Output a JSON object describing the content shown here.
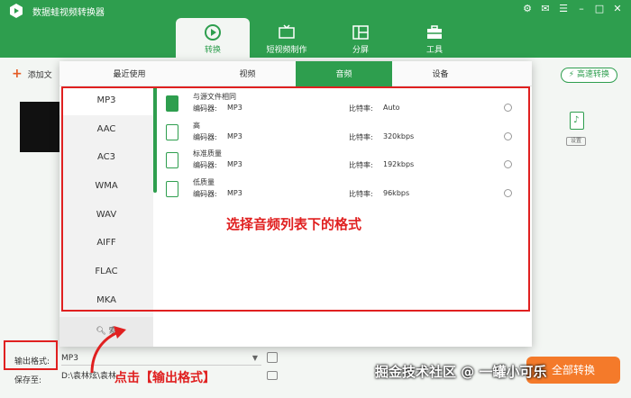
{
  "app": {
    "title": "数据蛙视频转换器"
  },
  "nav": [
    {
      "label": "转换",
      "icon": "convert-icon"
    },
    {
      "label": "短视频制作",
      "icon": "tv-icon"
    },
    {
      "label": "分屏",
      "icon": "split-screen-icon"
    },
    {
      "label": "工具",
      "icon": "toolbox-icon"
    }
  ],
  "main": {
    "add_file": "添加文",
    "fast_convert": "高速转换",
    "format_chip": {
      "settings": "设置"
    }
  },
  "popup": {
    "tabs": [
      "最近使用",
      "视频",
      "音频",
      "设备"
    ],
    "active_tab": "音频",
    "formats": [
      "MP3",
      "AAC",
      "AC3",
      "WMA",
      "WAV",
      "AIFF",
      "FLAC",
      "MKA"
    ],
    "active_format": "MP3",
    "search_label": "索",
    "quality": [
      {
        "name": "与源文件相同",
        "encoder_label": "编码器:",
        "encoder": "MP3",
        "bitrate_label": "比特率:",
        "bitrate": "Auto"
      },
      {
        "name": "高",
        "encoder_label": "编码器:",
        "encoder": "MP3",
        "bitrate_label": "比特率:",
        "bitrate": "320kbps"
      },
      {
        "name": "标准质量",
        "encoder_label": "编码器:",
        "encoder": "MP3",
        "bitrate_label": "比特率:",
        "bitrate": "192kbps"
      },
      {
        "name": "低质量",
        "encoder_label": "编码器:",
        "encoder": "MP3",
        "bitrate_label": "比特率:",
        "bitrate": "96kbps"
      }
    ]
  },
  "bottom": {
    "output_label": "输出格式:",
    "output_value": "MP3",
    "save_label": "保存至:",
    "save_path": "D:\\袁林炫\\袁林",
    "convert_all": "全部转换"
  },
  "annotations": {
    "main": "选择音频列表下的格式",
    "click": "点击【输出格式】",
    "watermark": "掘金技术社区 @ 一罐小可乐"
  },
  "colors": {
    "brand_green": "#2e9e4e",
    "accent_orange": "#f47a2a",
    "annotation_red": "#e02020"
  }
}
